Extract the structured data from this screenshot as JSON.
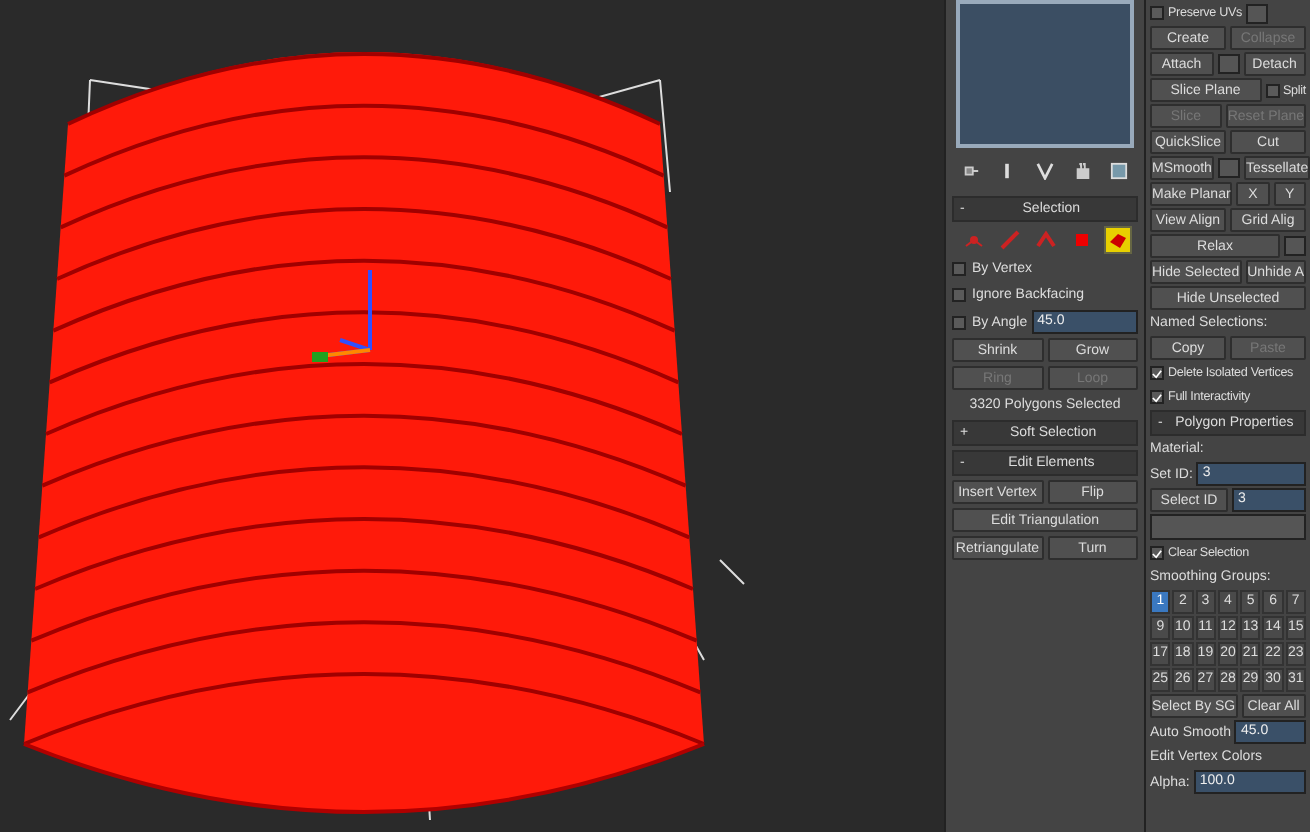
{
  "modifier_stack": {
    "toolbar": [
      {
        "kind": "pin"
      },
      {
        "kind": "bar"
      },
      {
        "kind": "fork"
      },
      {
        "kind": "hand"
      },
      {
        "kind": "config"
      }
    ]
  },
  "middle_panel": [
    [
      {
        "kind": "header",
        "sign": "-",
        "label": "Selection"
      }
    ],
    [
      {
        "kind": "subobjects",
        "items": [
          {
            "kind": "vertex",
            "selected": false
          },
          {
            "kind": "edge",
            "selected": false
          },
          {
            "kind": "border",
            "selected": false
          },
          {
            "kind": "polygon",
            "selected": false
          },
          {
            "kind": "element",
            "selected": true
          }
        ]
      }
    ],
    [
      {
        "kind": "checkbox",
        "label": "By Vertex",
        "checked": false
      }
    ],
    [
      {
        "kind": "checkbox",
        "label": "Ignore Backfacing",
        "checked": false
      }
    ],
    [
      {
        "kind": "checkbox",
        "label": "By Angle",
        "checked": false
      },
      {
        "kind": "spinner",
        "value": "45.0"
      }
    ],
    [
      {
        "kind": "button",
        "label": "Shrink",
        "disabled": false
      },
      {
        "kind": "button",
        "label": "Grow",
        "disabled": false
      }
    ],
    [
      {
        "kind": "button",
        "label": "Ring",
        "disabled": true
      },
      {
        "kind": "button",
        "label": "Loop",
        "disabled": true
      }
    ],
    [
      {
        "kind": "label",
        "label": "3320 Polygons Selected"
      }
    ],
    [
      {
        "kind": "header",
        "sign": "+",
        "label": "Soft Selection"
      }
    ],
    [
      {
        "kind": "header",
        "sign": "-",
        "label": "Edit Elements"
      }
    ],
    [
      {
        "kind": "button",
        "label": "Insert Vertex",
        "disabled": false
      },
      {
        "kind": "button",
        "label": "Flip",
        "disabled": false
      }
    ],
    [
      {
        "kind": "button",
        "label": "Edit Triangulation",
        "disabled": false
      }
    ],
    [
      {
        "kind": "button",
        "label": "Retriangulate",
        "disabled": false
      },
      {
        "kind": "button",
        "label": "Turn",
        "disabled": false
      }
    ]
  ],
  "right_panel": [
    [
      {
        "kind": "checkbox",
        "label": "Preserve UVs",
        "checked": false
      },
      {
        "kind": "settings"
      }
    ],
    [
      {
        "kind": "button",
        "label": "Create",
        "disabled": false
      },
      {
        "kind": "button",
        "label": "Collapse",
        "disabled": true
      }
    ],
    [
      {
        "kind": "button",
        "label": "Attach",
        "disabled": false
      },
      {
        "kind": "settings"
      },
      {
        "kind": "button",
        "label": "Detach",
        "disabled": false
      }
    ],
    [
      {
        "kind": "button",
        "label": "Slice Plane",
        "disabled": false
      },
      {
        "kind": "checkbox",
        "label": "Split",
        "checked": false
      }
    ],
    [
      {
        "kind": "button",
        "label": "Slice",
        "disabled": true
      },
      {
        "kind": "button",
        "label": "Reset Plane",
        "disabled": true
      }
    ],
    [
      {
        "kind": "button",
        "label": "QuickSlice",
        "disabled": false
      },
      {
        "kind": "button",
        "label": "Cut",
        "disabled": false
      }
    ],
    [
      {
        "kind": "button",
        "label": "MSmooth",
        "disabled": false
      },
      {
        "kind": "settings"
      },
      {
        "kind": "button",
        "label": "Tessellate",
        "disabled": false
      }
    ],
    [
      {
        "kind": "button",
        "label": "Make Planar",
        "disabled": false
      },
      {
        "kind": "button",
        "label": "X",
        "disabled": false
      },
      {
        "kind": "button",
        "label": "Y",
        "disabled": false
      }
    ],
    [
      {
        "kind": "button",
        "label": "View Align",
        "disabled": false
      },
      {
        "kind": "button",
        "label": "Grid Alig",
        "disabled": false
      }
    ],
    [
      {
        "kind": "button",
        "label": "Relax",
        "disabled": false
      },
      {
        "kind": "settings"
      }
    ],
    [
      {
        "kind": "button",
        "label": "Hide Selected",
        "disabled": false
      },
      {
        "kind": "button",
        "label": "Unhide A",
        "disabled": false
      }
    ],
    [
      {
        "kind": "button",
        "label": "Hide Unselected",
        "disabled": false
      }
    ],
    [
      {
        "kind": "label",
        "label": "Named Selections:"
      }
    ],
    [
      {
        "kind": "button",
        "label": "Copy",
        "disabled": false
      },
      {
        "kind": "button",
        "label": "Paste",
        "disabled": true
      }
    ],
    [
      {
        "kind": "checkbox",
        "label": "Delete Isolated Vertices",
        "checked": true
      }
    ],
    [
      {
        "kind": "checkbox",
        "label": "Full Interactivity",
        "checked": true
      }
    ],
    [
      {
        "kind": "header",
        "sign": "-",
        "label": "Polygon Properties"
      }
    ],
    [
      {
        "kind": "label",
        "label": "Material:"
      }
    ],
    [
      {
        "kind": "spinner",
        "label": "Set ID:",
        "value": "3"
      }
    ],
    [
      {
        "kind": "button",
        "label": "Select ID",
        "disabled": false
      },
      {
        "kind": "spinner",
        "value": "3"
      }
    ],
    [
      {
        "kind": "dropdown"
      }
    ],
    [
      {
        "kind": "checkbox",
        "label": "Clear Selection",
        "checked": true
      }
    ],
    [
      {
        "kind": "label",
        "label": "Smoothing Groups:"
      }
    ],
    [
      {
        "kind": "grid",
        "cells": [
          {
            "label": "1",
            "selected": true
          },
          {
            "label": "2",
            "selected": false
          },
          {
            "label": "3",
            "selected": false
          },
          {
            "label": "4",
            "selected": false
          },
          {
            "label": "5",
            "selected": false
          },
          {
            "label": "6",
            "selected": false
          },
          {
            "label": "7",
            "selected": false
          },
          {
            "label": "9",
            "selected": false
          },
          {
            "label": "10",
            "selected": false
          },
          {
            "label": "11",
            "selected": false
          },
          {
            "label": "12",
            "selected": false
          },
          {
            "label": "13",
            "selected": false
          },
          {
            "label": "14",
            "selected": false
          },
          {
            "label": "15",
            "selected": false
          },
          {
            "label": "17",
            "selected": false
          },
          {
            "label": "18",
            "selected": false
          },
          {
            "label": "19",
            "selected": false
          },
          {
            "label": "20",
            "selected": false
          },
          {
            "label": "21",
            "selected": false
          },
          {
            "label": "22",
            "selected": false
          },
          {
            "label": "23",
            "selected": false
          },
          {
            "label": "25",
            "selected": false
          },
          {
            "label": "26",
            "selected": false
          },
          {
            "label": "27",
            "selected": false
          },
          {
            "label": "28",
            "selected": false
          },
          {
            "label": "29",
            "selected": false
          },
          {
            "label": "30",
            "selected": false
          },
          {
            "label": "31",
            "selected": false
          }
        ]
      }
    ],
    [
      {
        "kind": "button",
        "label": "Select By SG",
        "disabled": false
      },
      {
        "kind": "button",
        "label": "Clear All",
        "disabled": false
      }
    ],
    [
      {
        "kind": "spinner",
        "label": "Auto Smooth",
        "value": "45.0"
      }
    ],
    [
      {
        "kind": "label",
        "label": "Edit Vertex Colors"
      }
    ],
    [
      {
        "kind": "spinner",
        "label": "Alpha:",
        "value": "100.0"
      }
    ]
  ]
}
